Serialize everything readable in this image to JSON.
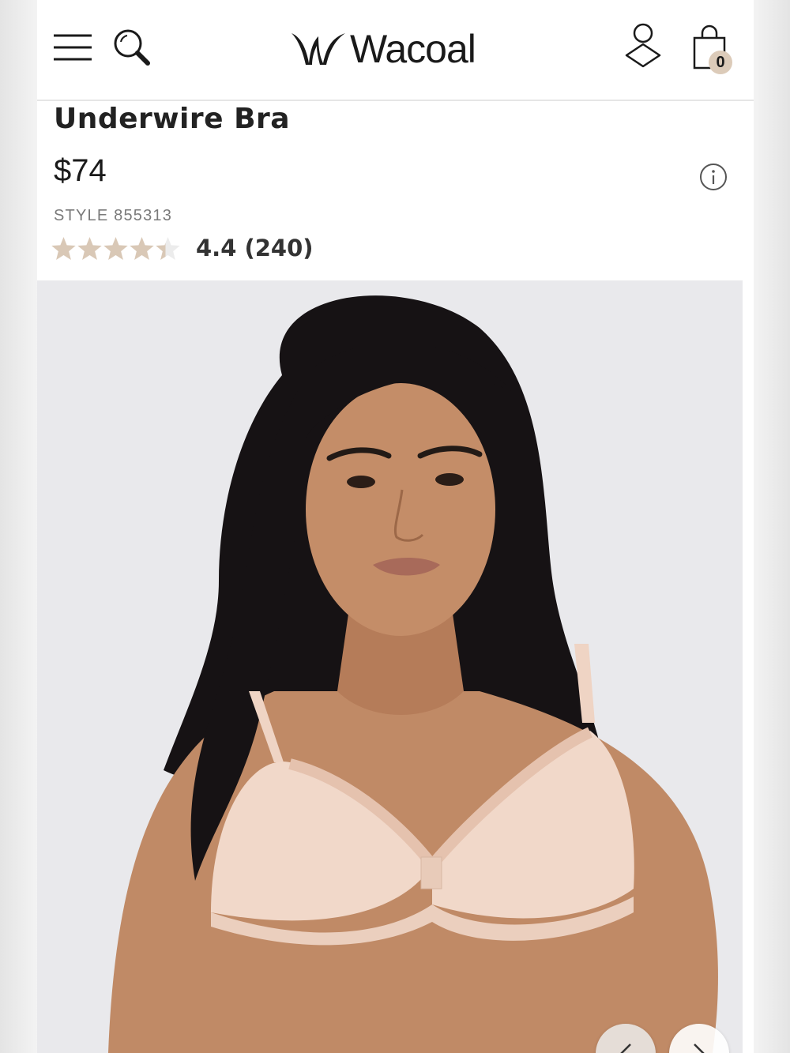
{
  "brand": {
    "name": "Wacoal"
  },
  "header": {
    "cart_count": "0"
  },
  "product": {
    "title": "Underwire Bra",
    "price": "$74",
    "style": "STYLE 855313",
    "rating": 4.4,
    "rating_text": "4.4 (240)",
    "image_alt": "Model wearing the Underwire Bra in sand"
  },
  "colors": {
    "star_filled": "#d9c8b6",
    "star_empty": "#ececec",
    "badge": "#dccbb9",
    "image_bg": "#e9e9ec",
    "skin": "#c08a66",
    "hair": "#161214",
    "bra": "#f1d8c9"
  },
  "icons": [
    "menu-icon",
    "search-icon",
    "wacoal-logo-mark",
    "account-icon",
    "shopping-bag-icon",
    "info-icon",
    "star-icon",
    "chevron-left-icon",
    "chevron-right-icon"
  ]
}
